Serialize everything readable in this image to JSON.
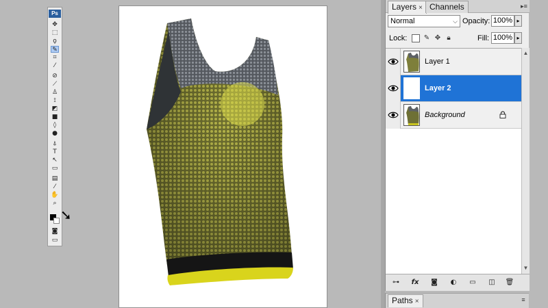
{
  "toolbox": {
    "logo": "Ps",
    "tools": [
      "move-tool",
      "marquee-tool",
      "lasso-tool",
      "quick-select-tool",
      "crop-tool",
      "eyedropper-tool",
      "healing-brush-tool",
      "brush-tool",
      "clone-stamp-tool",
      "history-brush-tool",
      "eraser-tool",
      "gradient-tool",
      "blur-tool",
      "dodge-tool",
      "pen-tool",
      "type-tool",
      "path-select-tool",
      "shape-tool",
      "notes-tool",
      "eyedropper-3d-tool",
      "hand-tool",
      "zoom-tool"
    ],
    "foreground_color": "#000000",
    "background_color": "#ffffff"
  },
  "layers_panel": {
    "tabs": [
      {
        "label": "Layers",
        "close": "×"
      },
      {
        "label": "Channels",
        "close": ""
      }
    ],
    "blend_mode": "Normal",
    "opacity_label": "Opacity:",
    "opacity_value": "100%",
    "lock_label": "Lock:",
    "fill_label": "Fill:",
    "fill_value": "100%",
    "layers": [
      {
        "name": "Layer 1",
        "selected": false,
        "visible": true,
        "locked": false
      },
      {
        "name": "Layer 2",
        "selected": true,
        "visible": true,
        "locked": false
      },
      {
        "name": "Background",
        "selected": false,
        "visible": true,
        "locked": true
      }
    ],
    "footer_icons": [
      "link-layers-icon",
      "fx-icon",
      "layer-mask-icon",
      "adjustment-layer-icon",
      "new-group-icon",
      "new-layer-icon",
      "trash-icon"
    ],
    "fx_label": "fx"
  },
  "paths_panel": {
    "tab_label": "Paths",
    "close": "×"
  },
  "colors": {
    "selection": "#1f73d6",
    "shirt_knit": "#8f8f3a",
    "waistband_yellow": "#d9d41c"
  }
}
